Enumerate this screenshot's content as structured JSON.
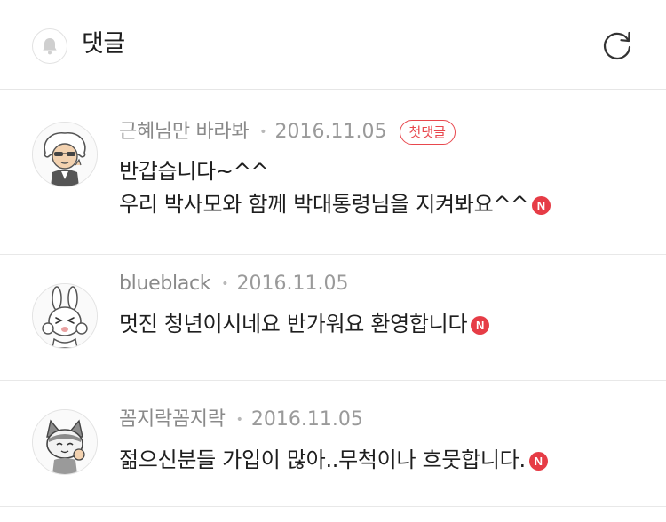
{
  "header": {
    "title": "댓글",
    "bell_icon": "bell-icon",
    "refresh_icon": "refresh-icon"
  },
  "colors": {
    "accent": "#e8474d",
    "meta_text": "#8a8a8a",
    "body_text": "#1e1e1e",
    "divider": "#e8e8e8"
  },
  "comments": [
    {
      "author": "근혜님만 바라봐",
      "date": "2016.11.05",
      "badge": "첫댓글",
      "lines": [
        "반갑습니다~^^",
        "우리 박사모와 함께 박대통령님을 지켜봐요^^"
      ],
      "new_mark": "N",
      "avatar_icon": "character-avatar-icon"
    },
    {
      "author": "blueblack",
      "date": "2016.11.05",
      "lines": [
        "멋진 청년이시네요 반가워요 환영합니다"
      ],
      "new_mark": "N",
      "avatar_icon": "rabbit-avatar-icon"
    },
    {
      "author": "꼼지락꼼지락",
      "date": "2016.11.05",
      "lines": [
        "젊으신분들 가입이 많아..무척이나 흐뭇합니다."
      ],
      "new_mark": "N",
      "avatar_icon": "cat-avatar-icon"
    }
  ]
}
